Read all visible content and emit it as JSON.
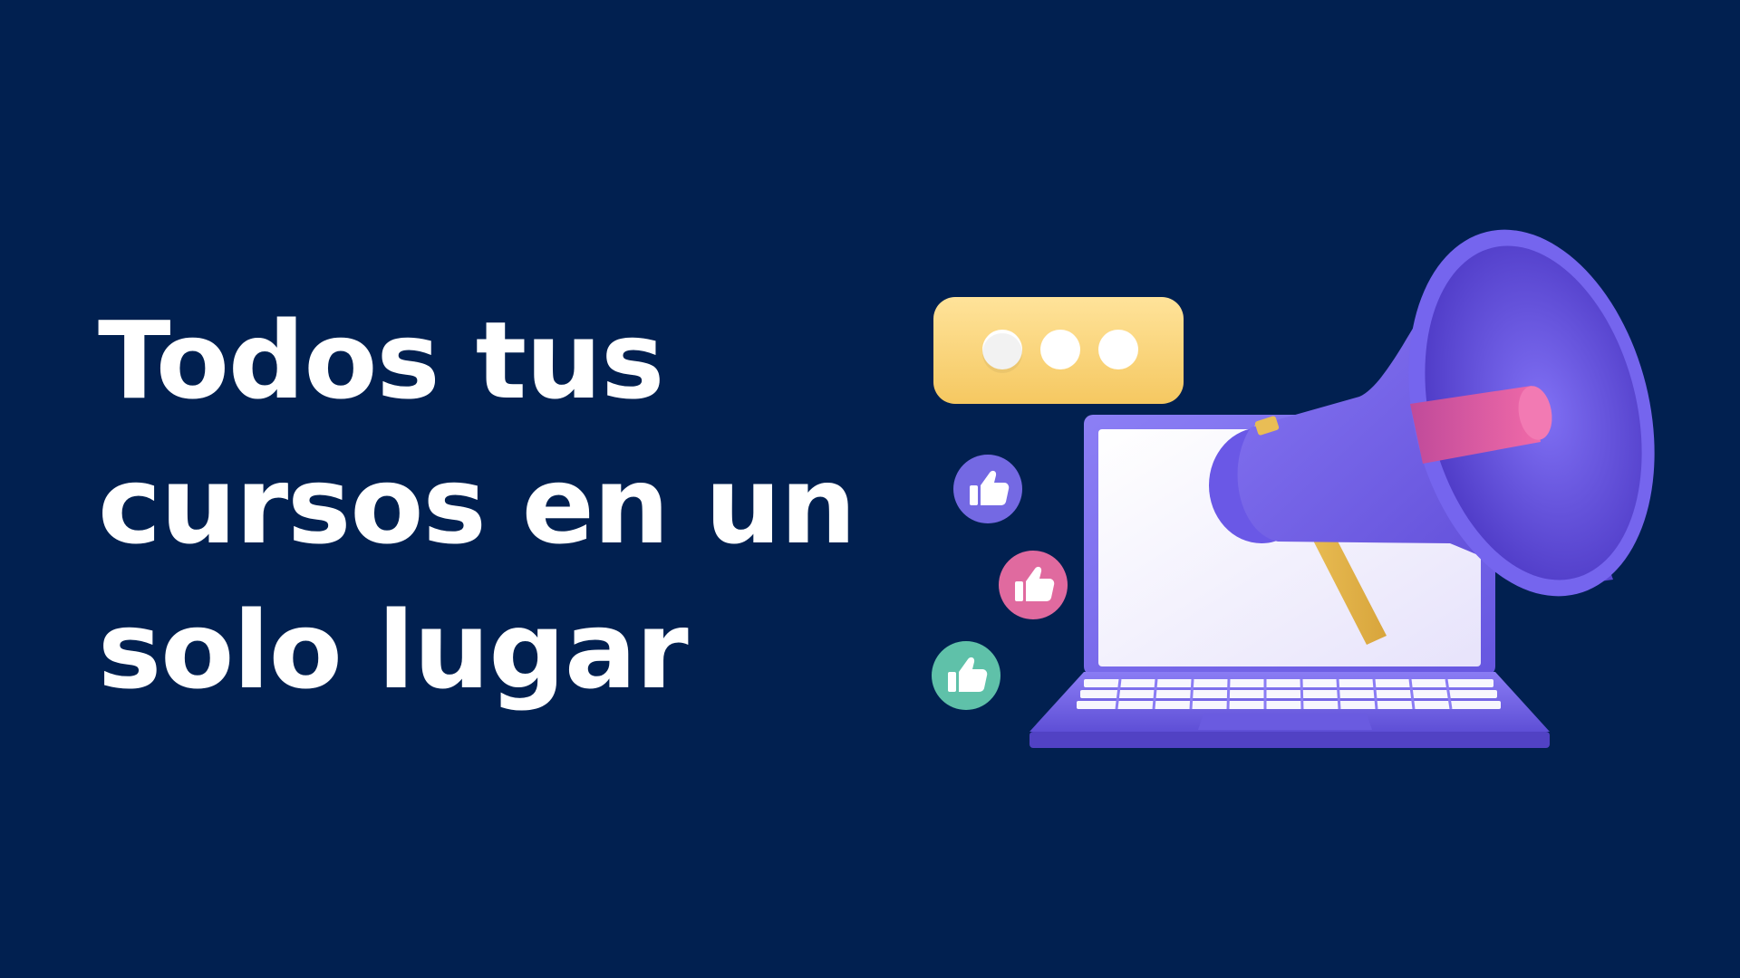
{
  "headline": {
    "lines": [
      "Todos tus",
      "cursos en un",
      "solo lugar"
    ]
  },
  "colors": {
    "background": "#012050",
    "text": "#ffffff",
    "speech_bubble": "#fbd67a",
    "laptop": "#7b6cf0",
    "megaphone": "#6f5ce8",
    "megaphone_handle": "#e6b84a",
    "like_purple": "#7469e3",
    "like_pink": "#e06a9f",
    "like_teal": "#5fc1a9"
  },
  "icons": {
    "speech_bubble": "typing-dots-icon",
    "likes": [
      "thumbs-up-icon",
      "thumbs-up-icon",
      "thumbs-up-icon"
    ],
    "laptop": "laptop-icon",
    "megaphone": "megaphone-icon"
  }
}
